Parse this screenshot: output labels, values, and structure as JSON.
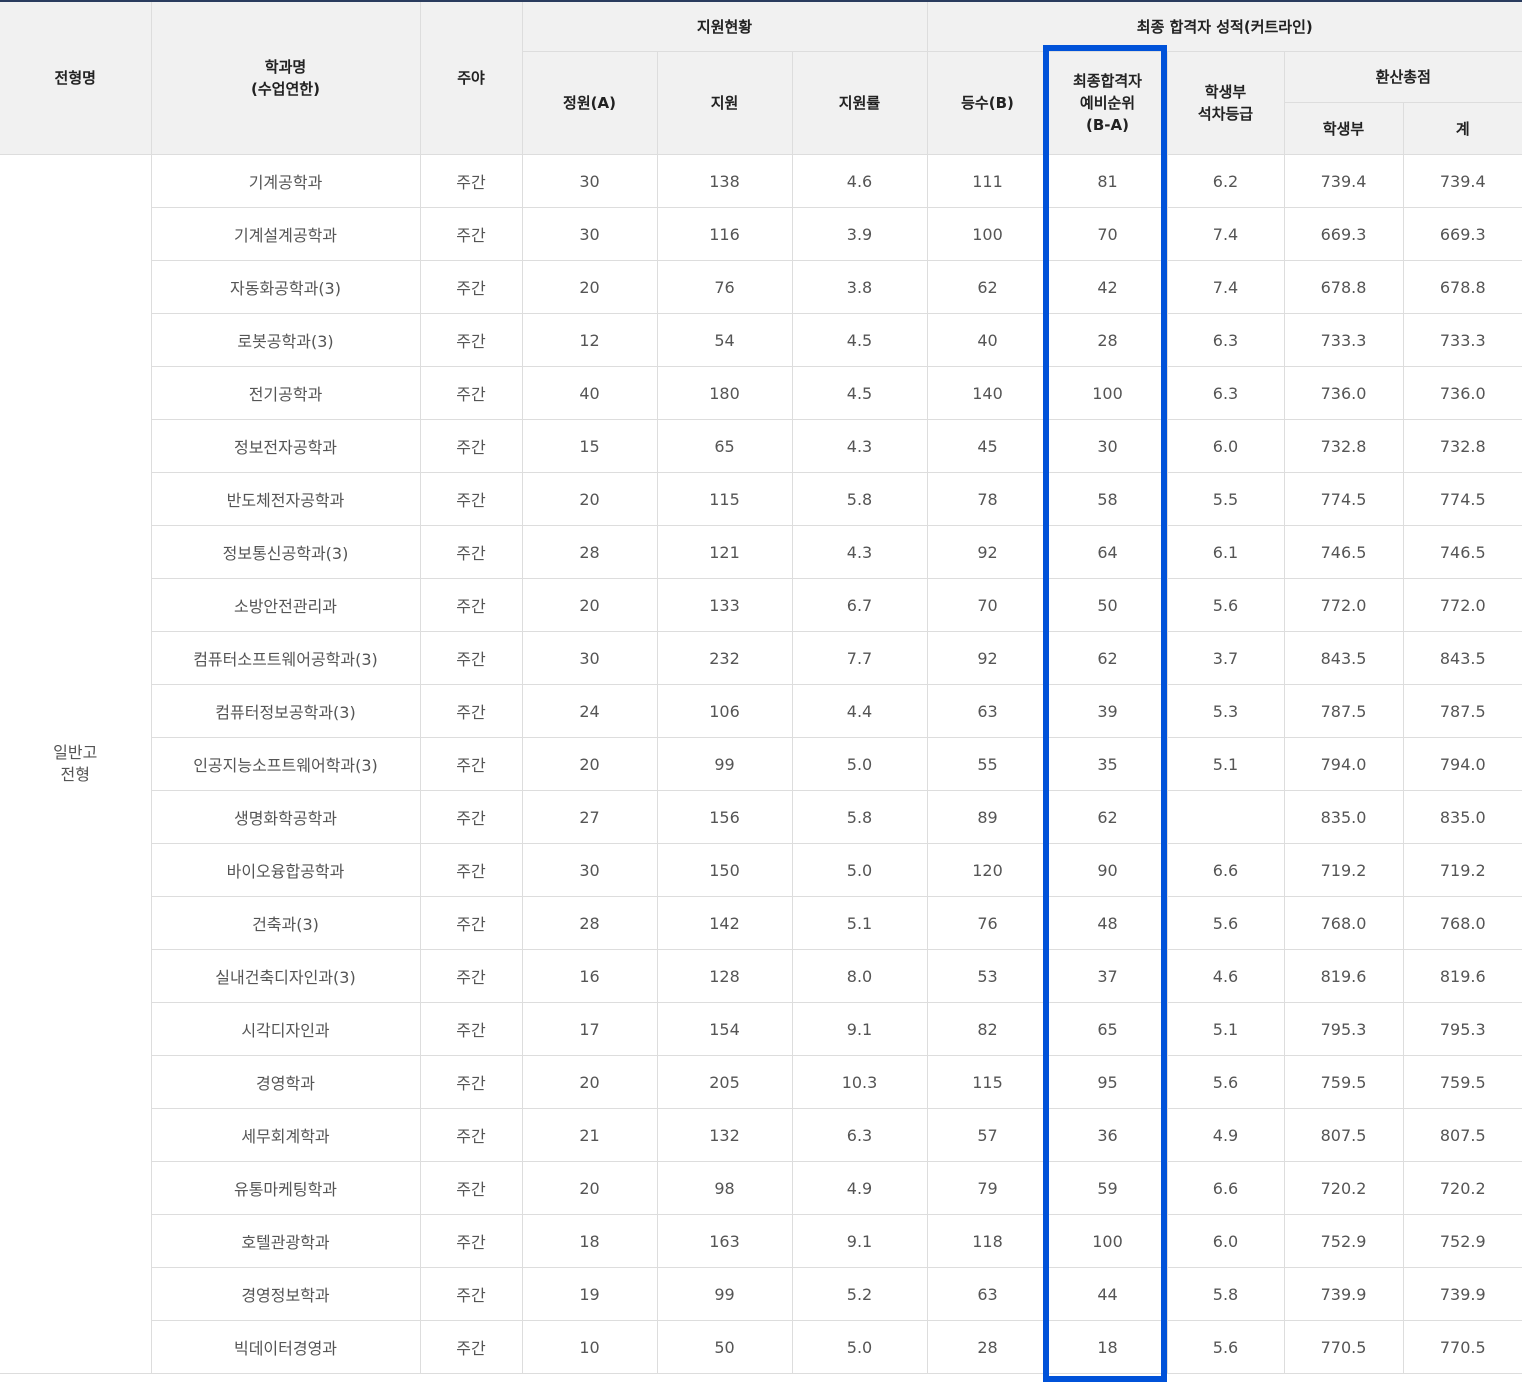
{
  "headers": {
    "type": "전형명",
    "dept_line1": "학과명",
    "dept_line2": "(수업연한)",
    "daynight": "주야",
    "apply_status": "지원현황",
    "final_score": "최종 합격자 성적(커트라인)",
    "quota": "정원(A)",
    "applicants": "지원",
    "ratio": "지원률",
    "rank": "등수(B)",
    "reserve_line1": "최종합격자",
    "reserve_line2": "예비순위",
    "reserve_line3": "(B-A)",
    "grade_line1": "학생부",
    "grade_line2": "석차등급",
    "total_score": "환산총점",
    "record": "학생부",
    "sum": "계"
  },
  "group": {
    "line1": "일반고",
    "line2": "전형"
  },
  "rows": [
    {
      "dept": "기계공학과",
      "dn": "주간",
      "quota": "30",
      "apply": "138",
      "ratio": "4.6",
      "rank": "111",
      "reserve": "81",
      "grade": "6.2",
      "record": "739.4",
      "sum": "739.4"
    },
    {
      "dept": "기계설계공학과",
      "dn": "주간",
      "quota": "30",
      "apply": "116",
      "ratio": "3.9",
      "rank": "100",
      "reserve": "70",
      "grade": "7.4",
      "record": "669.3",
      "sum": "669.3"
    },
    {
      "dept": "자동화공학과(3)",
      "dn": "주간",
      "quota": "20",
      "apply": "76",
      "ratio": "3.8",
      "rank": "62",
      "reserve": "42",
      "grade": "7.4",
      "record": "678.8",
      "sum": "678.8"
    },
    {
      "dept": "로봇공학과(3)",
      "dn": "주간",
      "quota": "12",
      "apply": "54",
      "ratio": "4.5",
      "rank": "40",
      "reserve": "28",
      "grade": "6.3",
      "record": "733.3",
      "sum": "733.3"
    },
    {
      "dept": "전기공학과",
      "dn": "주간",
      "quota": "40",
      "apply": "180",
      "ratio": "4.5",
      "rank": "140",
      "reserve": "100",
      "grade": "6.3",
      "record": "736.0",
      "sum": "736.0"
    },
    {
      "dept": "정보전자공학과",
      "dn": "주간",
      "quota": "15",
      "apply": "65",
      "ratio": "4.3",
      "rank": "45",
      "reserve": "30",
      "grade": "6.0",
      "record": "732.8",
      "sum": "732.8"
    },
    {
      "dept": "반도체전자공학과",
      "dn": "주간",
      "quota": "20",
      "apply": "115",
      "ratio": "5.8",
      "rank": "78",
      "reserve": "58",
      "grade": "5.5",
      "record": "774.5",
      "sum": "774.5"
    },
    {
      "dept": "정보통신공학과(3)",
      "dn": "주간",
      "quota": "28",
      "apply": "121",
      "ratio": "4.3",
      "rank": "92",
      "reserve": "64",
      "grade": "6.1",
      "record": "746.5",
      "sum": "746.5"
    },
    {
      "dept": "소방안전관리과",
      "dn": "주간",
      "quota": "20",
      "apply": "133",
      "ratio": "6.7",
      "rank": "70",
      "reserve": "50",
      "grade": "5.6",
      "record": "772.0",
      "sum": "772.0"
    },
    {
      "dept": "컴퓨터소프트웨어공학과(3)",
      "dn": "주간",
      "quota": "30",
      "apply": "232",
      "ratio": "7.7",
      "rank": "92",
      "reserve": "62",
      "grade": "3.7",
      "record": "843.5",
      "sum": "843.5"
    },
    {
      "dept": "컴퓨터정보공학과(3)",
      "dn": "주간",
      "quota": "24",
      "apply": "106",
      "ratio": "4.4",
      "rank": "63",
      "reserve": "39",
      "grade": "5.3",
      "record": "787.5",
      "sum": "787.5"
    },
    {
      "dept": "인공지능소프트웨어학과(3)",
      "dn": "주간",
      "quota": "20",
      "apply": "99",
      "ratio": "5.0",
      "rank": "55",
      "reserve": "35",
      "grade": "5.1",
      "record": "794.0",
      "sum": "794.0"
    },
    {
      "dept": "생명화학공학과",
      "dn": "주간",
      "quota": "27",
      "apply": "156",
      "ratio": "5.8",
      "rank": "89",
      "reserve": "62",
      "grade": "",
      "record": "835.0",
      "sum": "835.0"
    },
    {
      "dept": "바이오융합공학과",
      "dn": "주간",
      "quota": "30",
      "apply": "150",
      "ratio": "5.0",
      "rank": "120",
      "reserve": "90",
      "grade": "6.6",
      "record": "719.2",
      "sum": "719.2"
    },
    {
      "dept": "건축과(3)",
      "dn": "주간",
      "quota": "28",
      "apply": "142",
      "ratio": "5.1",
      "rank": "76",
      "reserve": "48",
      "grade": "5.6",
      "record": "768.0",
      "sum": "768.0"
    },
    {
      "dept": "실내건축디자인과(3)",
      "dn": "주간",
      "quota": "16",
      "apply": "128",
      "ratio": "8.0",
      "rank": "53",
      "reserve": "37",
      "grade": "4.6",
      "record": "819.6",
      "sum": "819.6"
    },
    {
      "dept": "시각디자인과",
      "dn": "주간",
      "quota": "17",
      "apply": "154",
      "ratio": "9.1",
      "rank": "82",
      "reserve": "65",
      "grade": "5.1",
      "record": "795.3",
      "sum": "795.3"
    },
    {
      "dept": "경영학과",
      "dn": "주간",
      "quota": "20",
      "apply": "205",
      "ratio": "10.3",
      "rank": "115",
      "reserve": "95",
      "grade": "5.6",
      "record": "759.5",
      "sum": "759.5"
    },
    {
      "dept": "세무회계학과",
      "dn": "주간",
      "quota": "21",
      "apply": "132",
      "ratio": "6.3",
      "rank": "57",
      "reserve": "36",
      "grade": "4.9",
      "record": "807.5",
      "sum": "807.5"
    },
    {
      "dept": "유통마케팅학과",
      "dn": "주간",
      "quota": "20",
      "apply": "98",
      "ratio": "4.9",
      "rank": "79",
      "reserve": "59",
      "grade": "6.6",
      "record": "720.2",
      "sum": "720.2"
    },
    {
      "dept": "호텔관광학과",
      "dn": "주간",
      "quota": "18",
      "apply": "163",
      "ratio": "9.1",
      "rank": "118",
      "reserve": "100",
      "grade": "6.0",
      "record": "752.9",
      "sum": "752.9"
    },
    {
      "dept": "경영정보학과",
      "dn": "주간",
      "quota": "19",
      "apply": "99",
      "ratio": "5.2",
      "rank": "63",
      "reserve": "44",
      "grade": "5.8",
      "record": "739.9",
      "sum": "739.9"
    },
    {
      "dept": "빅데이터경영과",
      "dn": "주간",
      "quota": "10",
      "apply": "50",
      "ratio": "5.0",
      "rank": "28",
      "reserve": "18",
      "grade": "5.6",
      "record": "770.5",
      "sum": "770.5"
    }
  ],
  "highlight_color": "#0052d9",
  "header_bg": "#f1f1f1",
  "border_color": "#dddddd"
}
